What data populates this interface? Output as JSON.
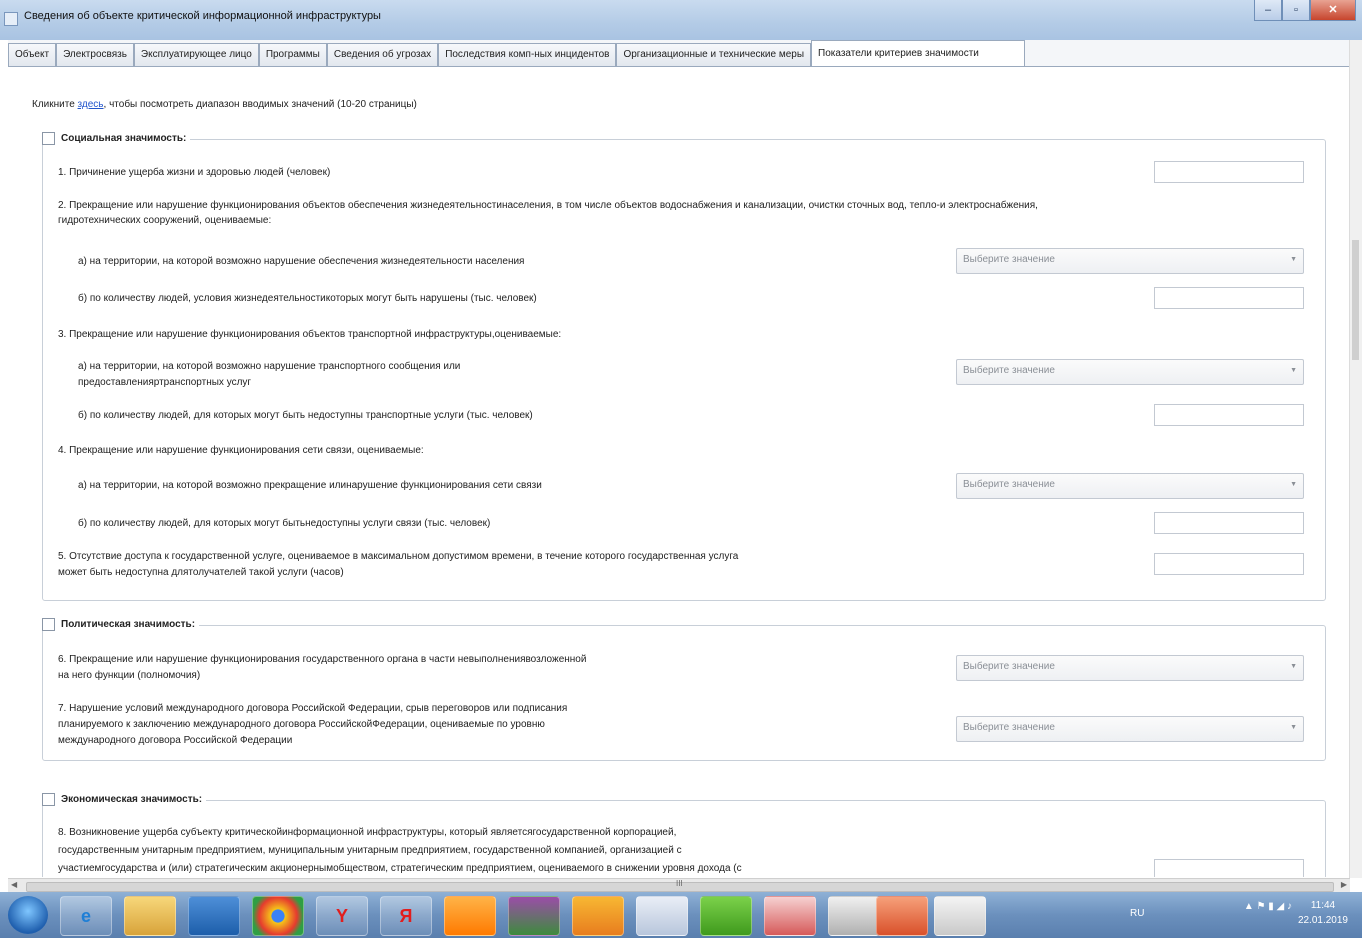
{
  "window": {
    "title": "Сведения об объекте критической информационной инфраструктуры",
    "minimize": "–",
    "restore": "▫",
    "close": "✕"
  },
  "tabs": [
    "Объект",
    "Электросвязь",
    "Эксплуатирующее лицо",
    "Программы",
    "Сведения об угрозах",
    "Последствия комп-ных инцидентов",
    "Организационные и технические меры",
    "Показатели критериев значимости"
  ],
  "hint": {
    "before": "Кликните ",
    "link": "здесь",
    "after": ", чтобы посмотреть диапазон вводимых значений (10-20 страницы)"
  },
  "select_placeholder": "Выберите значение",
  "groups": {
    "social": {
      "title": "Социальная значимость:",
      "q1": "1. Причинение ущерба жизни и здоровью людей (человек)",
      "q2_line1": "2. Прекращение или нарушение функционирования объектов обеспечения жизнедеятельностинаселения, в том числе объектов водоснабжения и канализации, очистки сточных вод, тепло-и электроснабжения,",
      "q2_line2": "гидротехнических сооружений, оцениваемые:",
      "q2a": "а) на территории, на которой возможно нарушение обеспечения жизнедеятельности населения",
      "q2b": "б) по количеству людей, условия жизнедеятельностикоторых могут быть нарушены (тыс. человек)",
      "q3": "3. Прекращение или нарушение функционирования объектов транспортной инфраструктуры,оцениваемые:",
      "q3a_line1": "а) на территории, на которой возможно нарушение транспортного сообщения или",
      "q3a_line2": "предоставленияртранспортных услуг",
      "q3b": "б) по количеству людей, для которых могут быть недоступны транспортные услуги (тыс. человек)",
      "q4": "4. Прекращение или нарушение функционирования сети связи, оцениваемые:",
      "q4a": "а) на территории, на которой возможно прекращение илинарушение функционирования сети связи",
      "q4b": "б) по количеству людей, для которых могут бытьнедоступны услуги связи (тыс. человек)",
      "q5_line1": "5. Отсутствие доступа к государственной услуге, оцениваемое в максимальном допустимом времени, в течение которого государственная услуга",
      "q5_line2": "может быть недоступна длятолучателей такой услуги (часов)"
    },
    "political": {
      "title": "Политическая значимость:",
      "q6_line1": "6. Прекращение или нарушение функционирования государственного органа в части невыполнениявозложенной",
      "q6_line2": "на него функции (полномочия)",
      "q7_line1": "7. Нарушение условий международного договора Российской Федерации, срыв переговоров или подписания",
      "q7_line2": "планируемого к заключению международного договора РоссийскойФедерации, оцениваемые по уровню",
      "q7_line3": "международного договора Российской Федерации"
    },
    "economic": {
      "title": "Экономическая значимость:",
      "q8_line1": "8. Возникновение ущерба субъекту критическойинформационной инфраструктуры, который являетсягосударственной корпорацией,",
      "q8_line2": "государственным унитарным предприятием, муниципальным унитарным предприятием, государственной компанией, организацией с",
      "q8_line3": "участиемгосударства и (или) стратегическим акционернымобществом, стратегическим предприятием, оцениваемого в снижении уровня дохода (с"
    }
  },
  "scroll_grip": "III",
  "taskbar": {
    "items": [
      "e",
      "",
      "",
      "",
      "Y",
      "Я",
      "",
      "",
      "",
      "",
      "",
      "",
      "",
      "",
      ""
    ],
    "lang": "RU",
    "time": "11:44",
    "date": "22.01.2019"
  },
  "colors": {
    "titlebar": "#b3cbe6",
    "taskbar": "#6b90bd",
    "link": "#2255cc"
  }
}
